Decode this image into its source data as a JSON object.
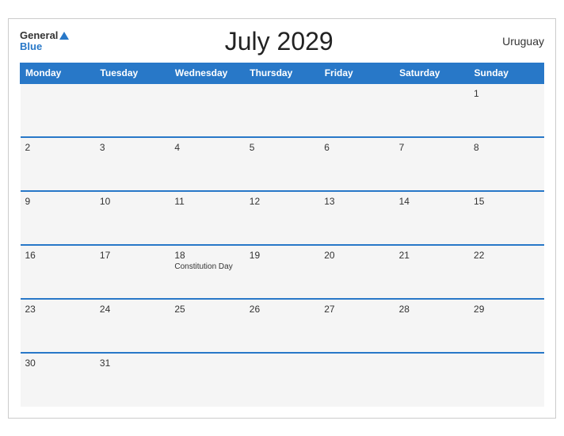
{
  "header": {
    "title": "July 2029",
    "country": "Uruguay",
    "logo_general": "General",
    "logo_blue": "Blue"
  },
  "weekdays": [
    "Monday",
    "Tuesday",
    "Wednesday",
    "Thursday",
    "Friday",
    "Saturday",
    "Sunday"
  ],
  "weeks": [
    [
      {
        "day": "",
        "empty": true
      },
      {
        "day": "",
        "empty": true
      },
      {
        "day": "",
        "empty": true
      },
      {
        "day": "",
        "empty": true
      },
      {
        "day": "",
        "empty": true
      },
      {
        "day": "",
        "empty": true
      },
      {
        "day": "1",
        "holiday": ""
      }
    ],
    [
      {
        "day": "2",
        "holiday": ""
      },
      {
        "day": "3",
        "holiday": ""
      },
      {
        "day": "4",
        "holiday": ""
      },
      {
        "day": "5",
        "holiday": ""
      },
      {
        "day": "6",
        "holiday": ""
      },
      {
        "day": "7",
        "holiday": ""
      },
      {
        "day": "8",
        "holiday": ""
      }
    ],
    [
      {
        "day": "9",
        "holiday": ""
      },
      {
        "day": "10",
        "holiday": ""
      },
      {
        "day": "11",
        "holiday": ""
      },
      {
        "day": "12",
        "holiday": ""
      },
      {
        "day": "13",
        "holiday": ""
      },
      {
        "day": "14",
        "holiday": ""
      },
      {
        "day": "15",
        "holiday": ""
      }
    ],
    [
      {
        "day": "16",
        "holiday": ""
      },
      {
        "day": "17",
        "holiday": ""
      },
      {
        "day": "18",
        "holiday": "Constitution Day"
      },
      {
        "day": "19",
        "holiday": ""
      },
      {
        "day": "20",
        "holiday": ""
      },
      {
        "day": "21",
        "holiday": ""
      },
      {
        "day": "22",
        "holiday": ""
      }
    ],
    [
      {
        "day": "23",
        "holiday": ""
      },
      {
        "day": "24",
        "holiday": ""
      },
      {
        "day": "25",
        "holiday": ""
      },
      {
        "day": "26",
        "holiday": ""
      },
      {
        "day": "27",
        "holiday": ""
      },
      {
        "day": "28",
        "holiday": ""
      },
      {
        "day": "29",
        "holiday": ""
      }
    ],
    [
      {
        "day": "30",
        "holiday": ""
      },
      {
        "day": "31",
        "holiday": ""
      },
      {
        "day": "",
        "empty": true
      },
      {
        "day": "",
        "empty": true
      },
      {
        "day": "",
        "empty": true
      },
      {
        "day": "",
        "empty": true
      },
      {
        "day": "",
        "empty": true
      }
    ]
  ]
}
